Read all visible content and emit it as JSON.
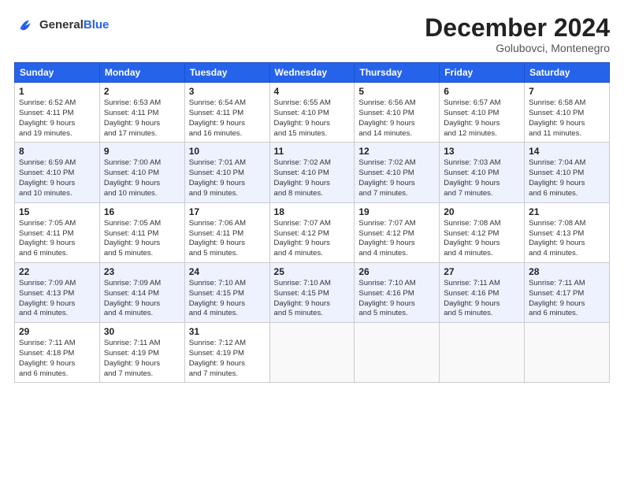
{
  "header": {
    "logo_line1": "General",
    "logo_line2": "Blue",
    "month_title": "December 2024",
    "location": "Golubovci, Montenegro"
  },
  "days_of_week": [
    "Sunday",
    "Monday",
    "Tuesday",
    "Wednesday",
    "Thursday",
    "Friday",
    "Saturday"
  ],
  "weeks": [
    [
      {
        "day": "1",
        "info": "Sunrise: 6:52 AM\nSunset: 4:11 PM\nDaylight: 9 hours\nand 19 minutes."
      },
      {
        "day": "2",
        "info": "Sunrise: 6:53 AM\nSunset: 4:11 PM\nDaylight: 9 hours\nand 17 minutes."
      },
      {
        "day": "3",
        "info": "Sunrise: 6:54 AM\nSunset: 4:11 PM\nDaylight: 9 hours\nand 16 minutes."
      },
      {
        "day": "4",
        "info": "Sunrise: 6:55 AM\nSunset: 4:10 PM\nDaylight: 9 hours\nand 15 minutes."
      },
      {
        "day": "5",
        "info": "Sunrise: 6:56 AM\nSunset: 4:10 PM\nDaylight: 9 hours\nand 14 minutes."
      },
      {
        "day": "6",
        "info": "Sunrise: 6:57 AM\nSunset: 4:10 PM\nDaylight: 9 hours\nand 12 minutes."
      },
      {
        "day": "7",
        "info": "Sunrise: 6:58 AM\nSunset: 4:10 PM\nDaylight: 9 hours\nand 11 minutes."
      }
    ],
    [
      {
        "day": "8",
        "info": "Sunrise: 6:59 AM\nSunset: 4:10 PM\nDaylight: 9 hours\nand 10 minutes."
      },
      {
        "day": "9",
        "info": "Sunrise: 7:00 AM\nSunset: 4:10 PM\nDaylight: 9 hours\nand 10 minutes."
      },
      {
        "day": "10",
        "info": "Sunrise: 7:01 AM\nSunset: 4:10 PM\nDaylight: 9 hours\nand 9 minutes."
      },
      {
        "day": "11",
        "info": "Sunrise: 7:02 AM\nSunset: 4:10 PM\nDaylight: 9 hours\nand 8 minutes."
      },
      {
        "day": "12",
        "info": "Sunrise: 7:02 AM\nSunset: 4:10 PM\nDaylight: 9 hours\nand 7 minutes."
      },
      {
        "day": "13",
        "info": "Sunrise: 7:03 AM\nSunset: 4:10 PM\nDaylight: 9 hours\nand 7 minutes."
      },
      {
        "day": "14",
        "info": "Sunrise: 7:04 AM\nSunset: 4:10 PM\nDaylight: 9 hours\nand 6 minutes."
      }
    ],
    [
      {
        "day": "15",
        "info": "Sunrise: 7:05 AM\nSunset: 4:11 PM\nDaylight: 9 hours\nand 6 minutes."
      },
      {
        "day": "16",
        "info": "Sunrise: 7:05 AM\nSunset: 4:11 PM\nDaylight: 9 hours\nand 5 minutes."
      },
      {
        "day": "17",
        "info": "Sunrise: 7:06 AM\nSunset: 4:11 PM\nDaylight: 9 hours\nand 5 minutes."
      },
      {
        "day": "18",
        "info": "Sunrise: 7:07 AM\nSunset: 4:12 PM\nDaylight: 9 hours\nand 4 minutes."
      },
      {
        "day": "19",
        "info": "Sunrise: 7:07 AM\nSunset: 4:12 PM\nDaylight: 9 hours\nand 4 minutes."
      },
      {
        "day": "20",
        "info": "Sunrise: 7:08 AM\nSunset: 4:12 PM\nDaylight: 9 hours\nand 4 minutes."
      },
      {
        "day": "21",
        "info": "Sunrise: 7:08 AM\nSunset: 4:13 PM\nDaylight: 9 hours\nand 4 minutes."
      }
    ],
    [
      {
        "day": "22",
        "info": "Sunrise: 7:09 AM\nSunset: 4:13 PM\nDaylight: 9 hours\nand 4 minutes."
      },
      {
        "day": "23",
        "info": "Sunrise: 7:09 AM\nSunset: 4:14 PM\nDaylight: 9 hours\nand 4 minutes."
      },
      {
        "day": "24",
        "info": "Sunrise: 7:10 AM\nSunset: 4:15 PM\nDaylight: 9 hours\nand 4 minutes."
      },
      {
        "day": "25",
        "info": "Sunrise: 7:10 AM\nSunset: 4:15 PM\nDaylight: 9 hours\nand 5 minutes."
      },
      {
        "day": "26",
        "info": "Sunrise: 7:10 AM\nSunset: 4:16 PM\nDaylight: 9 hours\nand 5 minutes."
      },
      {
        "day": "27",
        "info": "Sunrise: 7:11 AM\nSunset: 4:16 PM\nDaylight: 9 hours\nand 5 minutes."
      },
      {
        "day": "28",
        "info": "Sunrise: 7:11 AM\nSunset: 4:17 PM\nDaylight: 9 hours\nand 6 minutes."
      }
    ],
    [
      {
        "day": "29",
        "info": "Sunrise: 7:11 AM\nSunset: 4:18 PM\nDaylight: 9 hours\nand 6 minutes."
      },
      {
        "day": "30",
        "info": "Sunrise: 7:11 AM\nSunset: 4:19 PM\nDaylight: 9 hours\nand 7 minutes."
      },
      {
        "day": "31",
        "info": "Sunrise: 7:12 AM\nSunset: 4:19 PM\nDaylight: 9 hours\nand 7 minutes."
      },
      {
        "day": "",
        "info": ""
      },
      {
        "day": "",
        "info": ""
      },
      {
        "day": "",
        "info": ""
      },
      {
        "day": "",
        "info": ""
      }
    ]
  ]
}
